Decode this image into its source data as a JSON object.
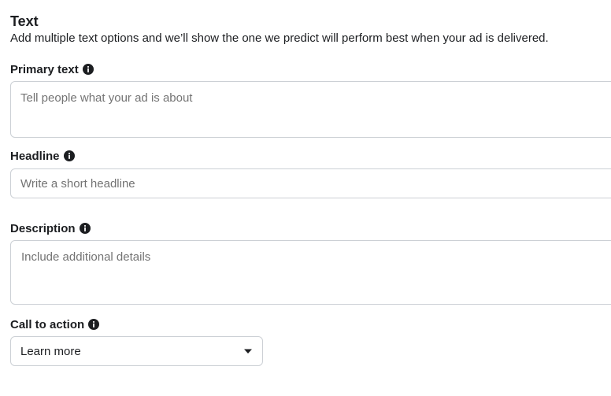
{
  "section": {
    "title": "Text",
    "subtitle": "Add multiple text options and we’ll show the one we predict will perform best when your ad is delivered."
  },
  "fields": {
    "primary_text": {
      "label": "Primary text",
      "placeholder": "Tell people what your ad is about",
      "value": ""
    },
    "headline": {
      "label": "Headline",
      "placeholder": "Write a short headline",
      "value": ""
    },
    "description": {
      "label": "Description",
      "placeholder": "Include additional details",
      "value": ""
    },
    "call_to_action": {
      "label": "Call to action",
      "selected": "Learn more"
    }
  },
  "icons": {
    "info": "info-icon",
    "dropdown": "caret-down-icon"
  },
  "colors": {
    "text": "#1c1e21",
    "placeholder": "#737373",
    "border": "#ccd0d5"
  }
}
